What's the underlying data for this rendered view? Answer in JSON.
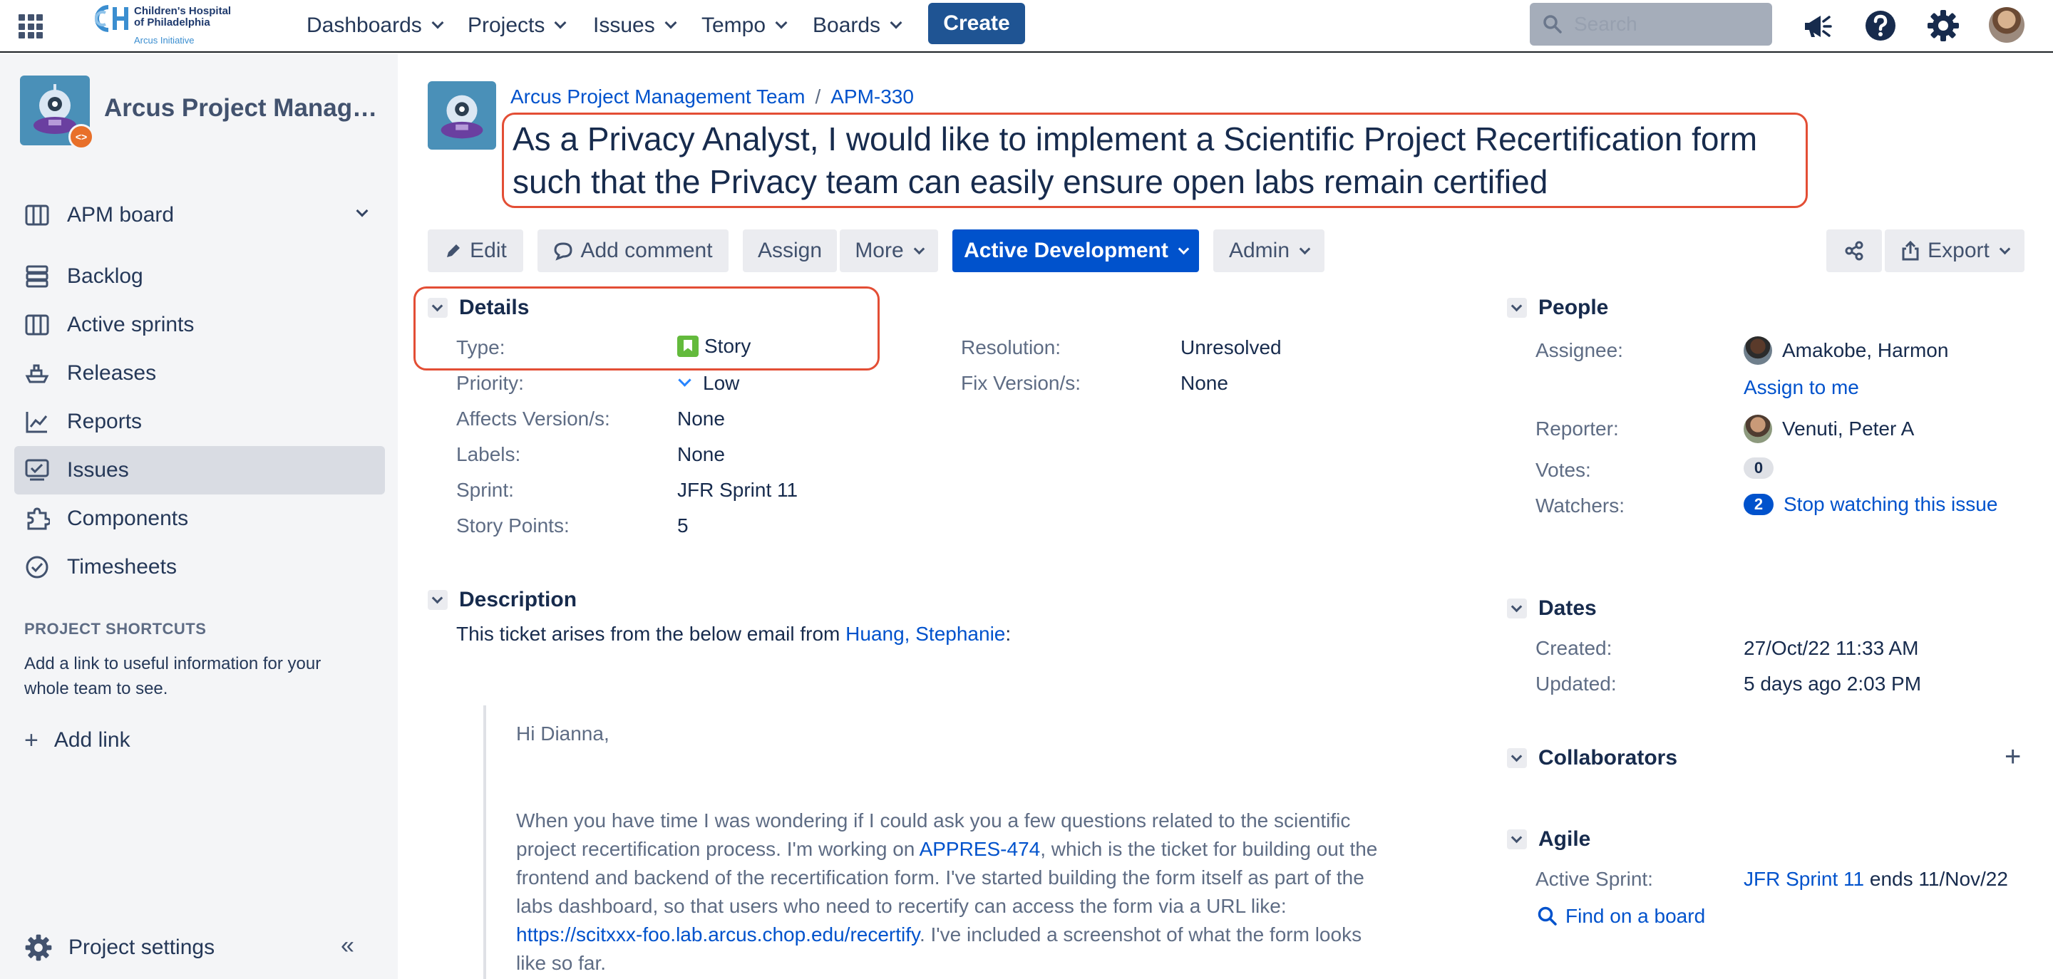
{
  "topnav": {
    "logo": {
      "line1": "Children's Hospital",
      "line2": "of Philadelphia",
      "line3": "Arcus Initiative"
    },
    "menus": [
      "Dashboards",
      "Projects",
      "Issues",
      "Tempo",
      "Boards"
    ],
    "create_label": "Create",
    "search_placeholder": "Search",
    "icons": [
      "apps-icon",
      "megaphone-icon",
      "help-icon",
      "gear-icon",
      "avatar"
    ]
  },
  "sidebar": {
    "project_name": "Arcus Project Management Team",
    "board_label": "APM board",
    "items": [
      {
        "label": "Backlog",
        "icon": "backlog-icon"
      },
      {
        "label": "Active sprints",
        "icon": "board-icon"
      },
      {
        "label": "Releases",
        "icon": "ship-icon"
      },
      {
        "label": "Reports",
        "icon": "chart-icon"
      },
      {
        "label": "Issues",
        "icon": "issues-icon",
        "active": true
      },
      {
        "label": "Components",
        "icon": "puzzle-icon"
      },
      {
        "label": "Timesheets",
        "icon": "clock-icon"
      }
    ],
    "shortcuts_title": "PROJECT SHORTCUTS",
    "shortcuts_text": "Add a link to useful information for your whole team to see.",
    "add_link": "Add link",
    "project_settings": "Project settings"
  },
  "issue": {
    "breadcrumb_project": "Arcus Project Management Team",
    "breadcrumb_sep": "/",
    "key": "APM-330",
    "summary": "As a Privacy Analyst, I would like to implement a Scientific Project Recertification form such that the Privacy team can easily ensure open labs remain certified"
  },
  "toolbar": {
    "edit": "Edit",
    "add_comment": "Add comment",
    "assign": "Assign",
    "more": "More",
    "status": "Active Development",
    "admin": "Admin",
    "export": "Export"
  },
  "details": {
    "title": "Details",
    "type_label": "Type:",
    "type_value": "Story",
    "priority_label": "Priority:",
    "priority_value": "Low",
    "affects_label": "Affects Version/s:",
    "affects_value": "None",
    "labels_label": "Labels:",
    "labels_value": "None",
    "sprint_label": "Sprint:",
    "sprint_value": "JFR Sprint 11",
    "points_label": "Story Points:",
    "points_value": "5",
    "resolution_label": "Resolution:",
    "resolution_value": "Unresolved",
    "fixversion_label": "Fix Version/s:",
    "fixversion_value": "None"
  },
  "description": {
    "title": "Description",
    "intro": "This ticket arises from the below email from ",
    "author_first": "Huang,",
    "author_second": "Stephanie",
    "intro_end": ":",
    "greeting": "Hi Dianna,",
    "body_pre": "When you have time I was wondering if I could ask you a few questions related to the scientific project recertification process. I'm working on ",
    "body_link": "APPRES-474",
    "body_mid": ", which is the ticket for building out the frontend and backend of the recertification form. I've started building the form itself as part of the labs dashboard, so that users who need to recertify can access the form via a URL like: ",
    "body_url": "https://scitxxx-foo.lab.arcus.chop.edu/recertify",
    "body_end": ". I've included a screenshot of what the form looks like so far."
  },
  "people": {
    "title": "People",
    "assignee_label": "Assignee:",
    "assignee_value": "Amakobe, Harmon",
    "assign_to_me": "Assign to me",
    "reporter_label": "Reporter:",
    "reporter_value": "Venuti, Peter A",
    "votes_label": "Votes:",
    "votes_value": "0",
    "watchers_label": "Watchers:",
    "watchers_value": "2",
    "stop_watching": "Stop watching this issue"
  },
  "dates": {
    "title": "Dates",
    "created_label": "Created:",
    "created_value": "27/Oct/22 11:33 AM",
    "updated_label": "Updated:",
    "updated_value": "5 days ago 2:03 PM"
  },
  "collaborators": {
    "title": "Collaborators"
  },
  "agile": {
    "title": "Agile",
    "sprint_label": "Active Sprint:",
    "sprint_link": "JFR Sprint 11",
    "sprint_ends": "ends 11/Nov/22",
    "find_on_board": "Find on a board"
  }
}
